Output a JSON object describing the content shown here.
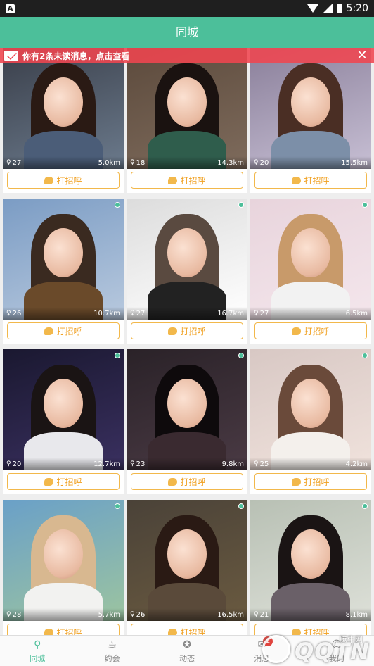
{
  "status_bar": {
    "time": "5:20",
    "notification_glyph": "A"
  },
  "header": {
    "title": "同城"
  },
  "message_banner": {
    "text": "你有2条未读消息，点击查看",
    "close_glyph": "✕"
  },
  "greet_label": "打招呼",
  "profiles": [
    {
      "age": "27",
      "distance": "5.0km",
      "online": false
    },
    {
      "age": "18",
      "distance": "14.3km",
      "online": false
    },
    {
      "age": "20",
      "distance": "15.5km",
      "online": false
    },
    {
      "age": "26",
      "distance": "10.7km",
      "online": true
    },
    {
      "age": "27",
      "distance": "16.7km",
      "online": true
    },
    {
      "age": "27",
      "distance": "6.5km",
      "online": true
    },
    {
      "age": "20",
      "distance": "12.7km",
      "online": true
    },
    {
      "age": "23",
      "distance": "9.8km",
      "online": true
    },
    {
      "age": "25",
      "distance": "4.2km",
      "online": true
    },
    {
      "age": "28",
      "distance": "5.7km",
      "online": true
    },
    {
      "age": "26",
      "distance": "16.5km",
      "online": true
    },
    {
      "age": "21",
      "distance": "8.1km",
      "online": true
    }
  ],
  "bottom_nav": [
    {
      "label": "同城",
      "icon": "location-pin-icon",
      "active": true
    },
    {
      "label": "约会",
      "icon": "coffee-cup-icon",
      "active": false
    },
    {
      "label": "动态",
      "icon": "compass-icon",
      "active": false
    },
    {
      "label": "消息",
      "icon": "chat-icon",
      "active": false,
      "badge": "2"
    },
    {
      "label": "我的",
      "icon": "user-icon",
      "active": false
    }
  ],
  "watermark": {
    "text": "QQTN",
    "subtitle": "腾牛网"
  },
  "colors": {
    "accent": "#4cbf9a",
    "greet": "#f2b84b",
    "banner": "#f04650"
  }
}
